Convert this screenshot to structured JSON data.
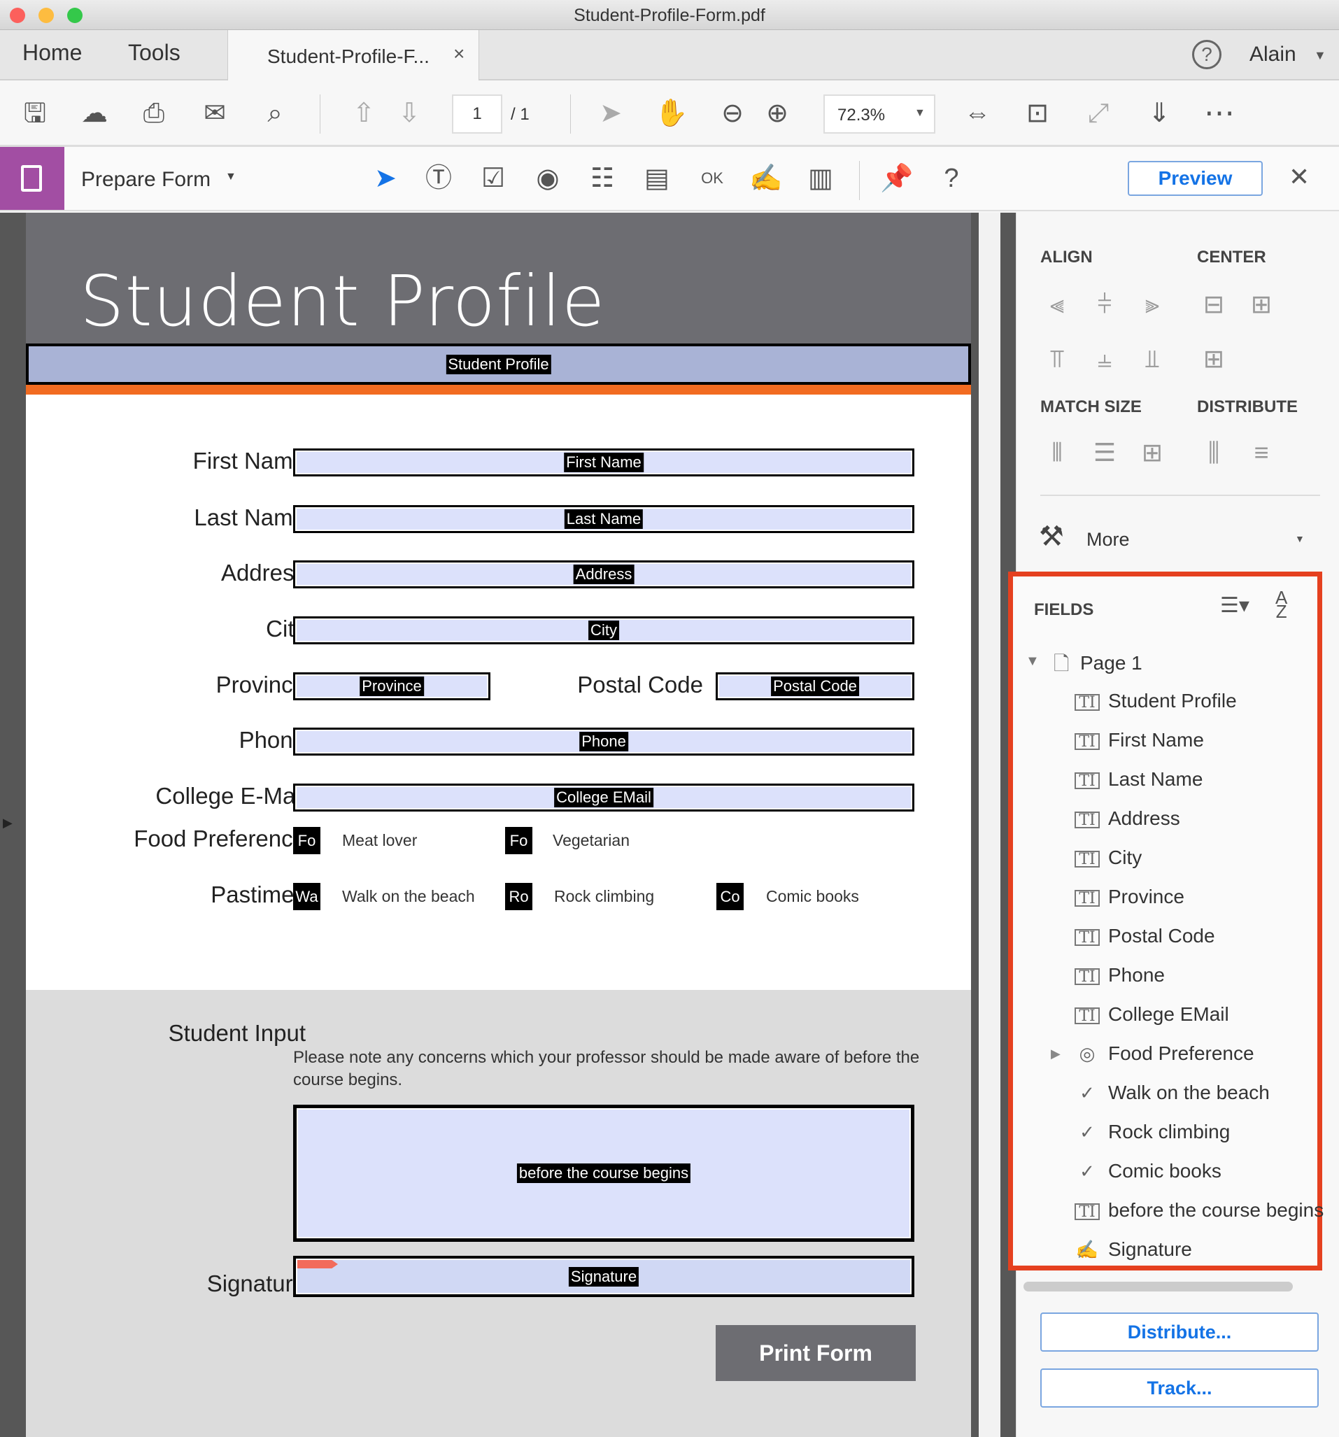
{
  "window": {
    "title": "Student-Profile-Form.pdf",
    "lights": [
      "#fc605c",
      "#fdbc40",
      "#34c84a"
    ]
  },
  "tabs": {
    "home": "Home",
    "tools": "Tools",
    "document": "Student-Profile-F...",
    "close": "×",
    "help": "?",
    "user": "Alain"
  },
  "toolbar": {
    "page_current": "1",
    "page_total": "/ 1",
    "zoom": "72.3%",
    "icons": [
      "save-icon",
      "cloud-upload-icon",
      "print-icon",
      "email-icon",
      "search-icon",
      "page-up-icon",
      "page-down-icon",
      "select-arrow-icon",
      "hand-icon",
      "zoom-out-icon",
      "zoom-in-icon",
      "fit-width-icon",
      "fit-page-icon",
      "full-screen-icon",
      "read-mode-icon",
      "more-icon"
    ]
  },
  "prepare": {
    "title": "Prepare Form",
    "preview": "Preview",
    "close": "✕",
    "tools": [
      "select-tool-icon",
      "text-field-icon",
      "checkbox-icon",
      "radio-button-icon",
      "list-box-icon",
      "dropdown-icon",
      "button-ok-icon",
      "signature-icon",
      "barcode-icon",
      "pin-icon",
      "help-icon"
    ]
  },
  "form": {
    "title": "Student Profile",
    "banner_tag": "Student Profile",
    "rows": [
      {
        "label": "First Name",
        "tag": "First Name"
      },
      {
        "label": "Last Name",
        "tag": "Last Name"
      },
      {
        "label": "Address",
        "tag": "Address"
      },
      {
        "label": "City",
        "tag": "City"
      },
      {
        "label": "Province",
        "tag": "Province",
        "label2": "Postal Code",
        "tag2": "Postal Code"
      },
      {
        "label": "Phone",
        "tag": "Phone"
      },
      {
        "label": "College E-Mail",
        "tag": "College EMail"
      }
    ],
    "food": {
      "label": "Food Preference",
      "options": [
        {
          "tag": "Fo",
          "text": "Meat lover"
        },
        {
          "tag": "Fo",
          "text": "Vegetarian"
        }
      ]
    },
    "pastimes": {
      "label": "Pastimes",
      "options": [
        {
          "tag": "Wa",
          "text": "Walk on the beach"
        },
        {
          "tag": "Ro",
          "text": "Rock climbing"
        },
        {
          "tag": "Co",
          "text": "Comic books"
        }
      ]
    },
    "student_input": {
      "label": "Student Input",
      "note": "Please note any concerns which your professor should be made aware of before the course begins.",
      "tag": "before the course begins"
    },
    "signature": {
      "label": "Signature",
      "tag": "Signature"
    },
    "print_button": "Print Form"
  },
  "panel": {
    "align": "ALIGN",
    "center": "CENTER",
    "match_size": "MATCH SIZE",
    "distribute": "DISTRIBUTE",
    "more": "More",
    "fields_title": "FIELDS",
    "page": "Page 1",
    "fields": [
      {
        "name": "Student Profile",
        "type": "text"
      },
      {
        "name": "First Name",
        "type": "text"
      },
      {
        "name": "Last Name",
        "type": "text"
      },
      {
        "name": "Address",
        "type": "text"
      },
      {
        "name": "City",
        "type": "text"
      },
      {
        "name": "Province",
        "type": "text"
      },
      {
        "name": "Postal Code",
        "type": "text"
      },
      {
        "name": "Phone",
        "type": "text"
      },
      {
        "name": "College EMail",
        "type": "text"
      },
      {
        "name": "Food Preference",
        "type": "radio-group"
      },
      {
        "name": "Walk on the beach",
        "type": "checkbox"
      },
      {
        "name": "Rock climbing",
        "type": "checkbox"
      },
      {
        "name": "Comic books",
        "type": "checkbox"
      },
      {
        "name": "before the course begins",
        "type": "text"
      },
      {
        "name": "Signature",
        "type": "signature"
      }
    ],
    "distribute_btn": "Distribute...",
    "track_btn": "Track..."
  },
  "colors": {
    "header": "#6d6d72",
    "banner": "#a9b3d6",
    "orange": "#f26b21",
    "field": "#dce1fb",
    "highlight": "#e5401f",
    "accent": "#1473e6",
    "prepare": "#a24ea3"
  }
}
